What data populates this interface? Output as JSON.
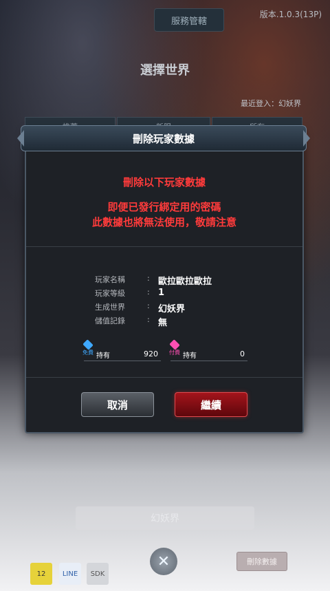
{
  "background": {
    "top_button": "服務管轄",
    "version": "版本.1.0.3(13P)",
    "title": "選擇世界",
    "last_login": "最近登入：幻妖界",
    "tabs": [
      "推薦",
      "新服",
      "所有"
    ],
    "world_button": "幻妖界",
    "delete_button": "刪除數據",
    "ratings": [
      "12",
      "LINE",
      "SDK"
    ]
  },
  "dialog": {
    "title": "刪除玩家數據",
    "warning_title": "刪除以下玩家數據",
    "warning_line1": "即便已發行綁定用的密碼",
    "warning_line2": "此數據也將無法使用，敬請注意",
    "info": [
      {
        "label": "玩家名稱",
        "colon": ":",
        "value": "歐拉歐拉歐拉"
      },
      {
        "label": "玩家等級",
        "colon": ":",
        "value": "1"
      },
      {
        "label": "生成世界",
        "colon": ":",
        "value": "幻妖界"
      },
      {
        "label": "儲值記錄",
        "colon": ":",
        "value": "無"
      }
    ],
    "currency_free": {
      "tag": "免費",
      "held_label": "持有",
      "value": "920",
      "color": "#3fa9ff"
    },
    "currency_paid": {
      "tag": "付費",
      "held_label": "持有",
      "value": "0",
      "color": "#ff4fb3"
    },
    "cancel_label": "取消",
    "continue_label": "繼續"
  }
}
